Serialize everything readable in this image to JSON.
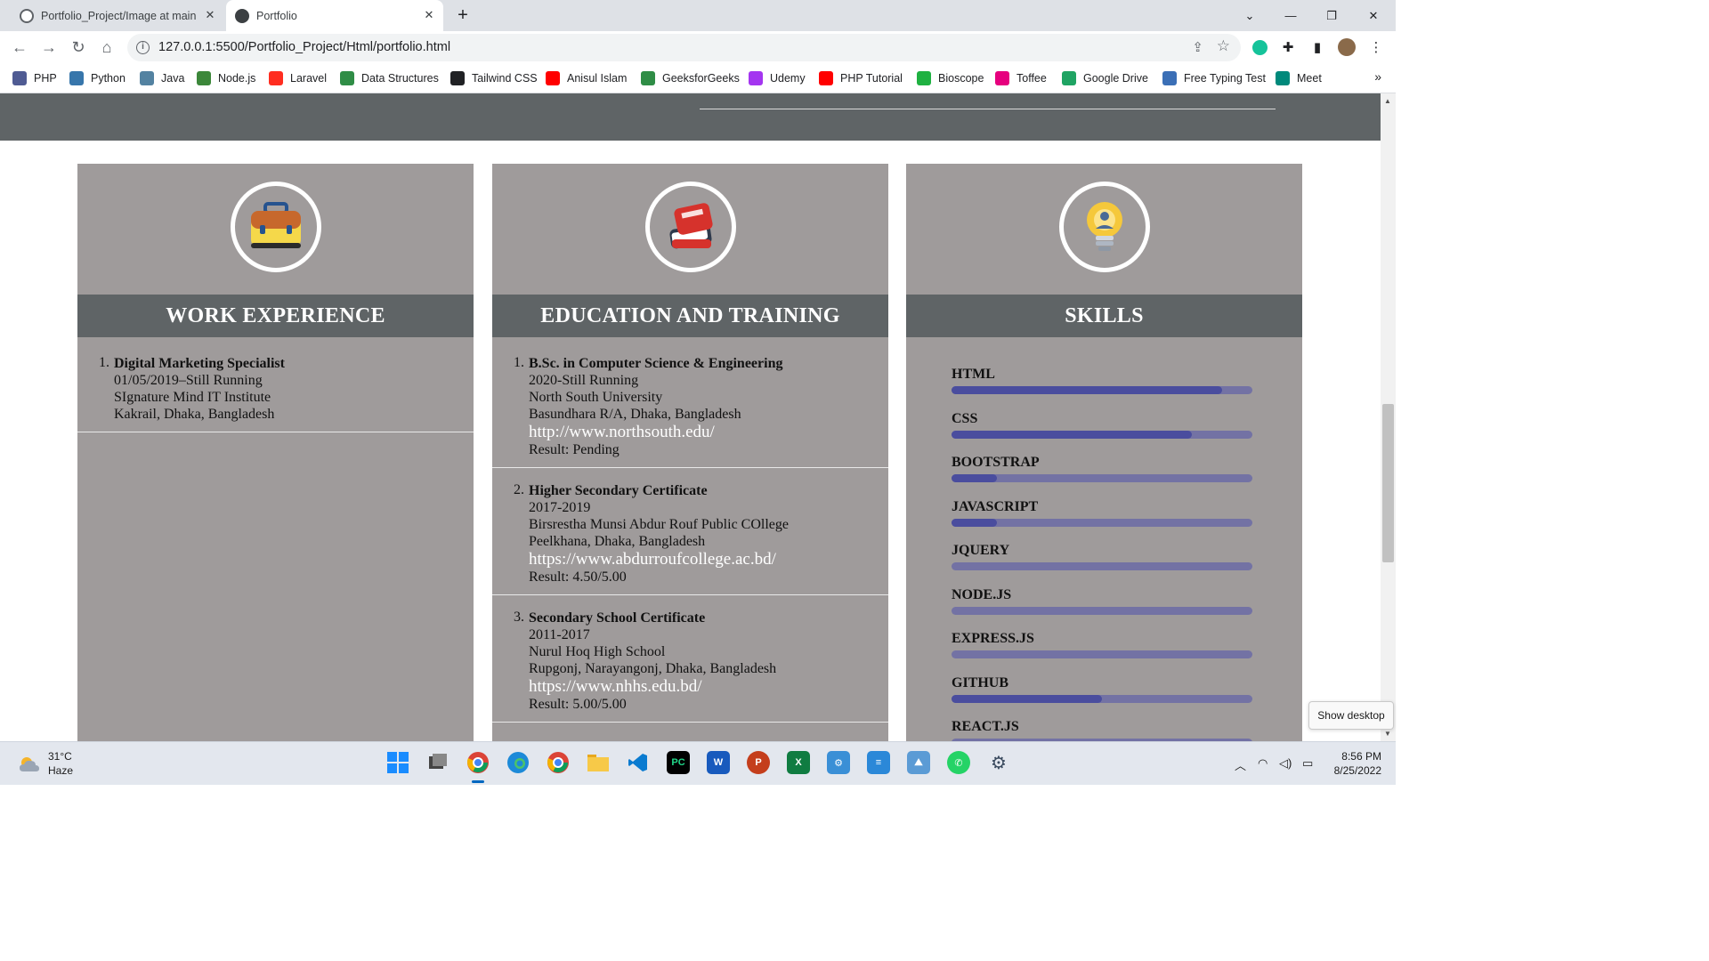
{
  "browser": {
    "tabs": [
      {
        "title": "Portfolio_Project/Image at main · ",
        "active": false
      },
      {
        "title": "Portfolio",
        "active": true
      }
    ],
    "url": "127.0.0.1:5500/Portfolio_Project/Html/portfolio.html",
    "bookmarks": [
      {
        "label": "PHP",
        "icon": "php-icon",
        "color": "#4f5b93"
      },
      {
        "label": "Python",
        "icon": "python-icon",
        "color": "#3776ab"
      },
      {
        "label": "Java",
        "icon": "java-icon",
        "color": "#5382a1"
      },
      {
        "label": "Node.js",
        "icon": "nodejs-icon",
        "color": "#3c873a"
      },
      {
        "label": "Laravel",
        "icon": "laravel-icon",
        "color": "#ff2d20"
      },
      {
        "label": "Data Structures",
        "icon": "geeksforgeeks-icon",
        "color": "#2f8d46"
      },
      {
        "label": "Tailwind CSS",
        "icon": "globe-icon",
        "color": "#202124"
      },
      {
        "label": "Anisul Islam",
        "icon": "youtube-icon",
        "color": "#ff0000"
      },
      {
        "label": "GeeksforGeeks",
        "icon": "geeksforgeeks-icon",
        "color": "#2f8d46"
      },
      {
        "label": "Udemy",
        "icon": "udemy-icon",
        "color": "#a435f0"
      },
      {
        "label": "PHP Tutorial",
        "icon": "youtube-icon",
        "color": "#ff0000"
      },
      {
        "label": "Bioscope",
        "icon": "bioscope-icon",
        "color": "#1fb141"
      },
      {
        "label": "Toffee",
        "icon": "toffee-icon",
        "color": "#e6007e"
      },
      {
        "label": "Google Drive",
        "icon": "google-drive-icon",
        "color": "#1fa463"
      },
      {
        "label": "Free Typing Test",
        "icon": "typing-icon",
        "color": "#3b6fb6"
      },
      {
        "label": "Meet",
        "icon": "meet-icon",
        "color": "#00897b"
      }
    ]
  },
  "page": {
    "cards": [
      {
        "title": "WORK EXPERIENCE",
        "icon": "briefcase-icon"
      },
      {
        "title": "EDUCATION AND TRAINING",
        "icon": "books-icon"
      },
      {
        "title": "SKILLS",
        "icon": "lightbulb-icon"
      }
    ],
    "work": [
      {
        "num": "1.",
        "title": "Digital Marketing Specialist",
        "lines": [
          "01/05/2019–Still Running",
          "SIgnature Mind IT Institute",
          "Kakrail, Dhaka, Bangladesh"
        ]
      }
    ],
    "education": [
      {
        "num": "1.",
        "title": "B.Sc. in Computer Science & Engineering",
        "lines": [
          "2020-Still Running",
          "North South University",
          "Basundhara R/A, Dhaka, Bangladesh"
        ],
        "link": "http://www.northsouth.edu/",
        "result": "Result: Pending"
      },
      {
        "num": "2.",
        "title": "Higher Secondary Certificate",
        "lines": [
          "2017-2019",
          "Birsrestha Munsi Abdur Rouf Public COllege",
          "Peelkhana, Dhaka, Bangladesh"
        ],
        "link": "https://www.abdurroufcollege.ac.bd/",
        "result": "Result: 4.50/5.00"
      },
      {
        "num": "3.",
        "title": "Secondary School Certificate",
        "lines": [
          "2011-2017",
          "Nurul Hoq High School",
          "Rupgonj, Narayangonj, Dhaka, Bangladesh"
        ],
        "link": "https://www.nhhs.edu.bd/",
        "result": "Result: 5.00/5.00"
      }
    ],
    "skills": [
      {
        "name": "HTML",
        "level": 0.9
      },
      {
        "name": "CSS",
        "level": 0.8
      },
      {
        "name": "BOOTSTRAP",
        "level": 0.15
      },
      {
        "name": "JAVASCRIPT",
        "level": 0.15
      },
      {
        "name": "JQUERY",
        "level": 0.0
      },
      {
        "name": "NODE.JS",
        "level": 0.0
      },
      {
        "name": "EXPRESS.JS",
        "level": 0.0
      },
      {
        "name": "GITHUB",
        "level": 0.5
      },
      {
        "name": "REACT.JS",
        "level": 0.0
      }
    ]
  },
  "taskbar": {
    "weather_temp": "31°C",
    "weather_desc": "Haze",
    "time": "8:56 PM",
    "date": "8/25/2022",
    "tooltip": "Show desktop"
  },
  "colors": {
    "card_bg": "#9f9b9b",
    "band_bg": "#5f6466",
    "skill_track": "#7372a4",
    "skill_fill": "#4a4d9e"
  }
}
